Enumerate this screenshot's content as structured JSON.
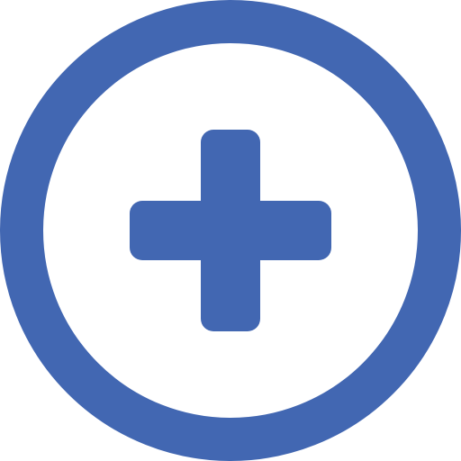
{
  "icon": {
    "name": "add-circle-icon",
    "color": "#4267B2",
    "background": "#FFFFFF"
  }
}
